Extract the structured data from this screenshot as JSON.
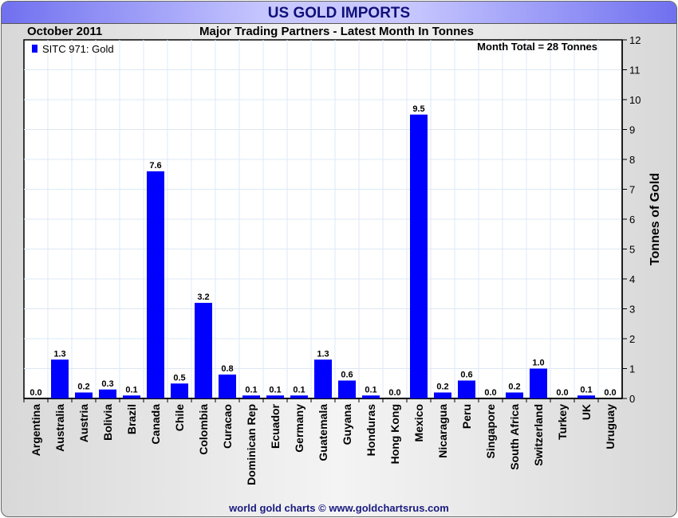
{
  "header": {
    "title": "US GOLD IMPORTS",
    "date": "October 2011",
    "subtitle": "Major Trading Partners - Latest Month In Tonnes"
  },
  "footer": "world gold charts © www.goldchartsrus.com",
  "colors": {
    "bar": "#0000ff",
    "title_bg": "#c8c8ff"
  },
  "chart_data": {
    "type": "bar",
    "title": "Major Trading Partners - Latest Month In Tonnes",
    "ylabel": "Tonnes of Gold",
    "xlabel": "",
    "ylim": [
      0,
      12
    ],
    "yticks": [
      "0",
      "1",
      "2",
      "3",
      "4",
      "5",
      "6",
      "7",
      "8",
      "9",
      "10",
      "11",
      "12"
    ],
    "legend": {
      "label": "SITC 971: Gold",
      "placement": "top-left"
    },
    "annotation": "Month Total = 28 Tonnes",
    "categories": [
      "Argentina",
      "Australia",
      "Austria",
      "Bolivia",
      "Brazil",
      "Canada",
      "Chile",
      "Colombia",
      "Curacao",
      "Dominican Rep",
      "Ecuador",
      "Germany",
      "Guatemala",
      "Guyana",
      "Honduras",
      "Hong Kong",
      "Mexico",
      "Nicaragua",
      "Peru",
      "Singapore",
      "South Africa",
      "Switzerland",
      "Turkey",
      "UK",
      "Uruguay"
    ],
    "values": [
      0.0,
      1.3,
      0.2,
      0.3,
      0.1,
      7.6,
      0.5,
      3.2,
      0.8,
      0.1,
      0.1,
      0.1,
      1.3,
      0.6,
      0.1,
      0.0,
      9.5,
      0.2,
      0.6,
      0.0,
      0.2,
      1.0,
      0.0,
      0.1,
      0.0
    ],
    "value_labels": [
      "0.0",
      "1.3",
      "0.2",
      "0.3",
      "0.1",
      "7.6",
      "0.5",
      "3.2",
      "0.8",
      "0.1",
      "0.1",
      "0.1",
      "1.3",
      "0.6",
      "0.1",
      "0.0",
      "9.5",
      "0.2",
      "0.6",
      "0.0",
      "0.2",
      "1.0",
      "0.0",
      "0.1",
      "0.0"
    ]
  }
}
